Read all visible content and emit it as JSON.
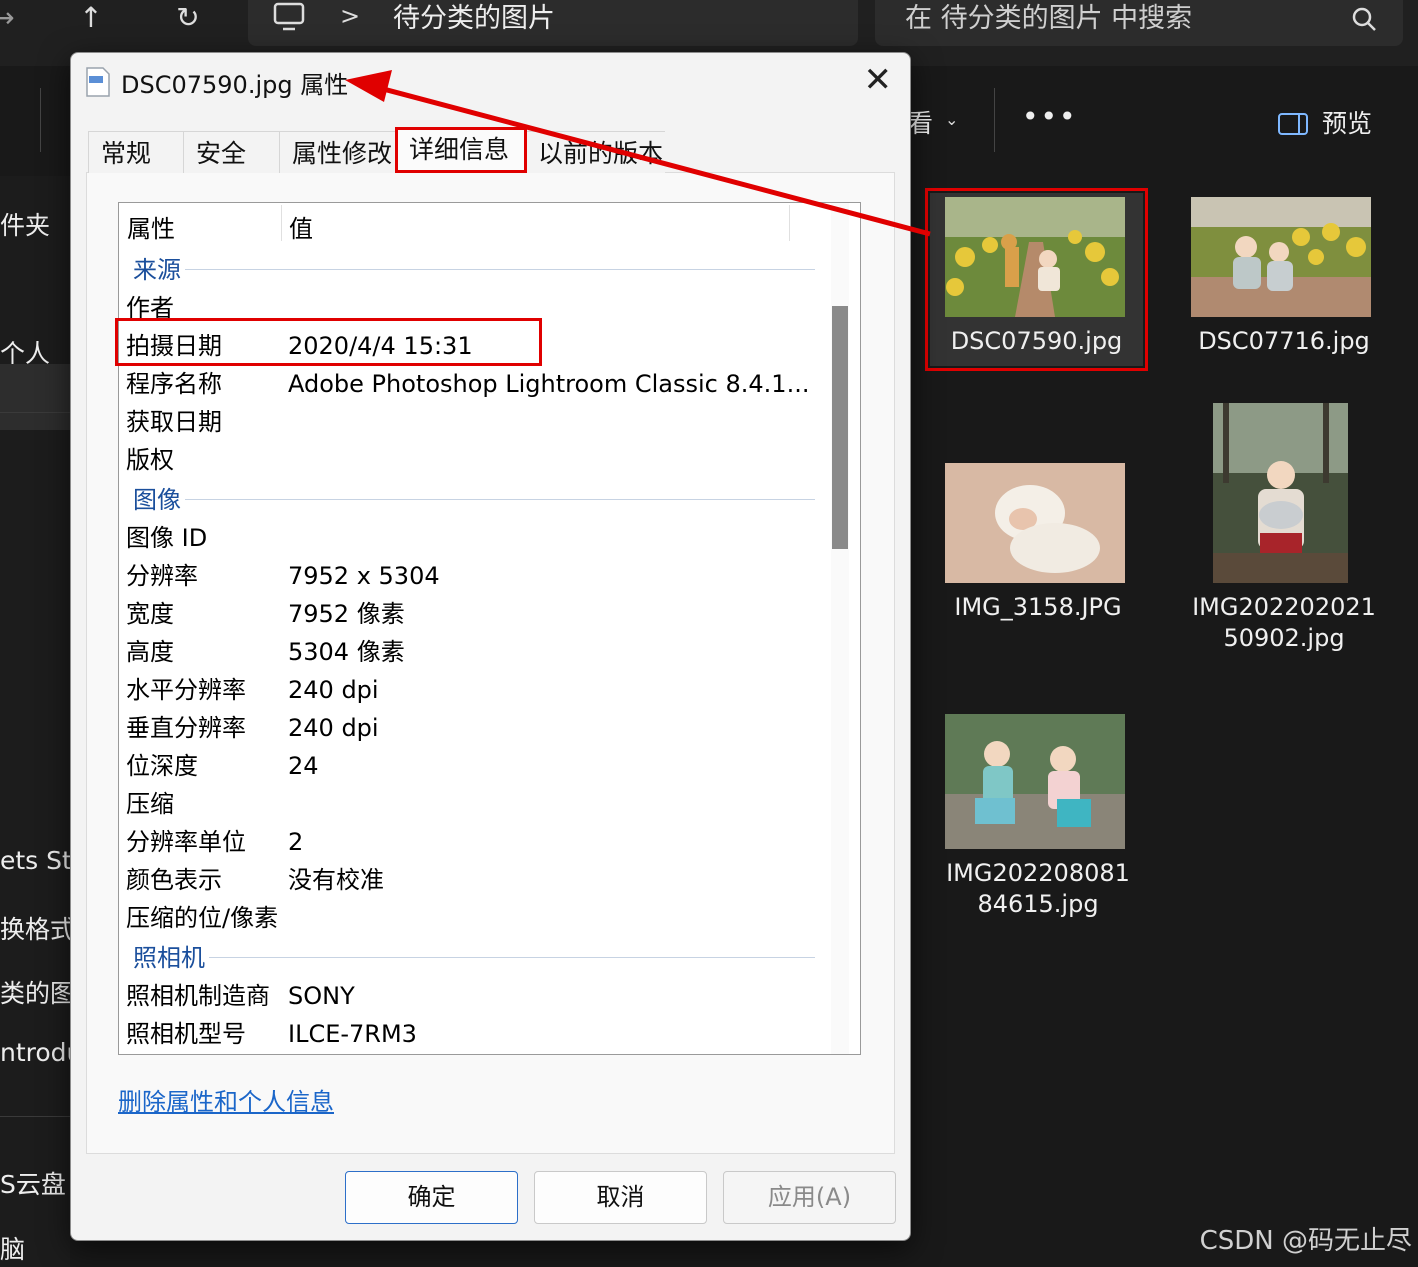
{
  "explorer": {
    "address": {
      "pc_icon": "monitor-icon",
      "separator": ">",
      "path": "待分类的图片"
    },
    "search": {
      "placeholder": "在 待分类的图片 中搜索"
    },
    "toolbar": {
      "view_label": "看",
      "more_label": "•••",
      "preview_label": "预览"
    },
    "sidebar": {
      "items": [
        "件夹",
        "个人",
        "ets Sta",
        "换格式",
        "类的图",
        "ntrodu",
        "S云盘",
        "脑"
      ]
    },
    "files": [
      {
        "name": "DSC07590.jpg",
        "selected": true
      },
      {
        "name": "DSC07716.jpg"
      },
      {
        "name": "IMG_3158.JPG"
      },
      {
        "name_line1": "IMG202202021",
        "name_line2": "50902.jpg"
      },
      {
        "name_line1": "IMG202208081",
        "name_line2": "84615.jpg"
      }
    ]
  },
  "dialog": {
    "title": "DSC07590.jpg 属性",
    "tabs": [
      "常规",
      "安全",
      "属性修改",
      "详细信息",
      "以前的版本"
    ],
    "active_tab": "详细信息",
    "columns": {
      "property": "属性",
      "value": "值"
    },
    "groups": {
      "source": "来源",
      "image": "图像",
      "camera": "照相机"
    },
    "rows": {
      "author": {
        "k": "作者",
        "v": ""
      },
      "date_taken": {
        "k": "拍摄日期",
        "v": "2020/4/4 15:31"
      },
      "program": {
        "k": "程序名称",
        "v": "Adobe Photoshop Lightroom Classic 8.4.1..."
      },
      "acquired": {
        "k": "获取日期",
        "v": ""
      },
      "copyright": {
        "k": "版权",
        "v": ""
      },
      "image_id": {
        "k": "图像 ID",
        "v": ""
      },
      "resolution": {
        "k": "分辨率",
        "v": "7952 x 5304"
      },
      "width": {
        "k": "宽度",
        "v": "7952 像素"
      },
      "height": {
        "k": "高度",
        "v": "5304 像素"
      },
      "hres": {
        "k": "水平分辨率",
        "v": "240 dpi"
      },
      "vres": {
        "k": "垂直分辨率",
        "v": "240 dpi"
      },
      "bitdepth": {
        "k": "位深度",
        "v": "24"
      },
      "compression": {
        "k": "压缩",
        "v": ""
      },
      "resunit": {
        "k": "分辨率单位",
        "v": "2"
      },
      "colorrep": {
        "k": "颜色表示",
        "v": "没有校准"
      },
      "compbits": {
        "k": "压缩的位/像素",
        "v": ""
      },
      "maker": {
        "k": "照相机制造商",
        "v": "SONY"
      },
      "model": {
        "k": "照相机型号",
        "v": "ILCE-7RM3"
      }
    },
    "remove_link": "删除属性和个人信息",
    "buttons": {
      "ok": "确定",
      "cancel": "取消",
      "apply": "应用(A)"
    }
  },
  "watermark": "CSDN @码无止尽",
  "colors": {
    "highlight": "#e00000",
    "group_text": "#1b4f9c",
    "link": "#1b66c9"
  }
}
